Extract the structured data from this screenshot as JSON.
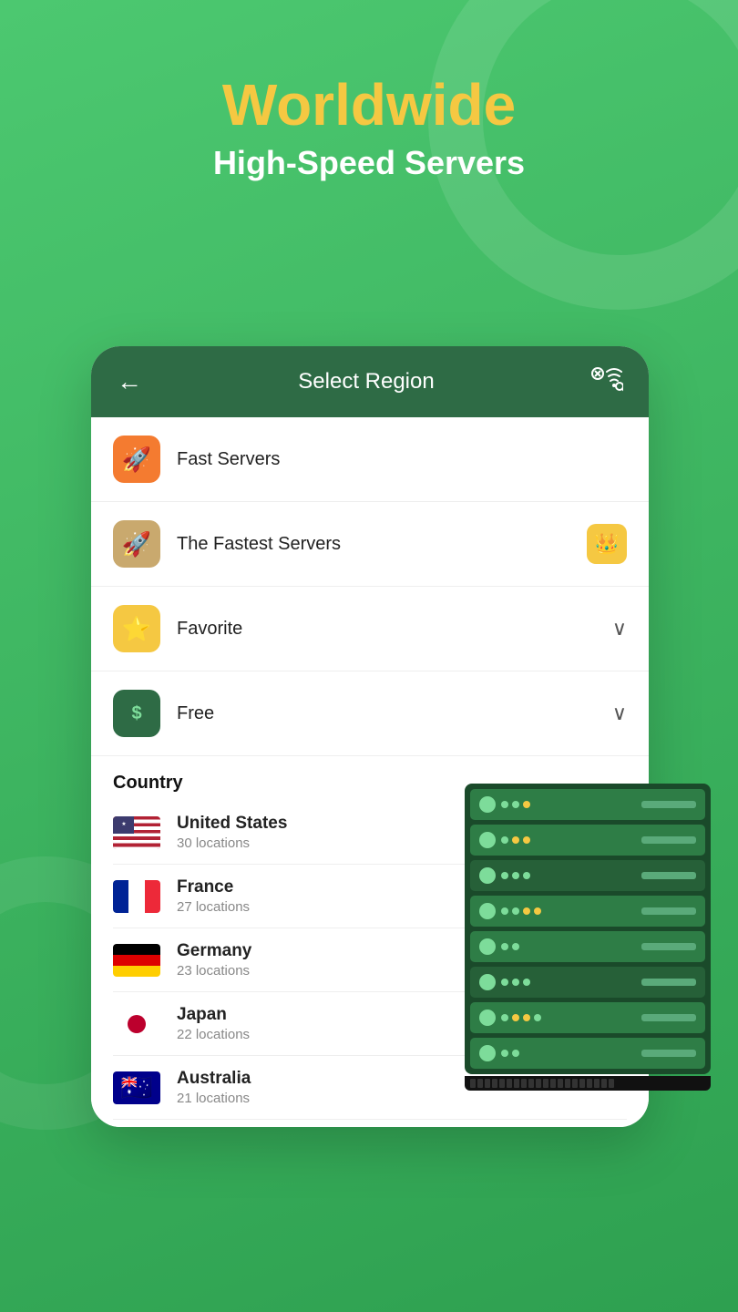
{
  "background": {
    "color": "#3cb862"
  },
  "header": {
    "title": "Worldwide",
    "subtitle": "High-Speed Servers"
  },
  "card": {
    "header": {
      "back_icon": "←",
      "title": "Select Region",
      "wifi_icon": "⊗ ≋"
    },
    "menu_items": [
      {
        "id": "fast-servers",
        "icon": "🚀",
        "icon_bg": "orange",
        "label": "Fast Servers",
        "right": ""
      },
      {
        "id": "fastest-servers",
        "icon": "🚀",
        "icon_bg": "tan",
        "label": "The Fastest Servers",
        "right": "crown"
      },
      {
        "id": "favorite",
        "icon": "⭐",
        "icon_bg": "yellow",
        "label": "Favorite",
        "right": "chevron"
      },
      {
        "id": "free",
        "icon": "$",
        "icon_bg": "green",
        "label": "Free",
        "right": "chevron"
      }
    ],
    "country_section": {
      "heading": "Country",
      "countries": [
        {
          "id": "us",
          "name": "United States",
          "locations": "30 locations",
          "flag_type": "usa"
        },
        {
          "id": "fr",
          "name": "France",
          "locations": "27 locations",
          "flag_type": "france"
        },
        {
          "id": "de",
          "name": "Germany",
          "locations": "23 locations",
          "flag_type": "germany"
        },
        {
          "id": "jp",
          "name": "Japan",
          "locations": "22 locations",
          "flag_type": "japan"
        },
        {
          "id": "au",
          "name": "Australia",
          "locations": "21 locations",
          "flag_type": "australia"
        }
      ]
    }
  }
}
